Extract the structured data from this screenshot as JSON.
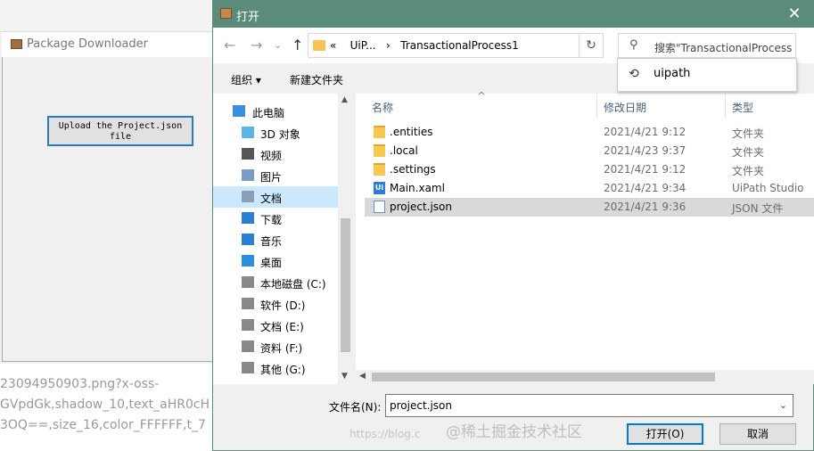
{
  "background_app": {
    "title": "Package Downloader",
    "upload_button": "Upload the Project.json file",
    "url_lines": [
      "23094950903.png?x-oss-",
      "GVpdGk,shadow_10,text_aHR0cH",
      "3OQ==,size_16,color_FFFFFF,t_7"
    ]
  },
  "dialog": {
    "title": "打开",
    "address": {
      "prefix": "«",
      "crumbs": [
        "UiP...",
        "TransactionalProcess1"
      ]
    },
    "search_placeholder": "搜索\"TransactionalProcess",
    "suggestion": "uipath",
    "toolbar": {
      "organize": "组织 ▾",
      "new_folder": "新建文件夹"
    },
    "tree": [
      {
        "label": "此电脑",
        "icon": "computer-icon",
        "selected": false
      },
      {
        "label": "3D 对象",
        "icon": "cube-icon",
        "selected": false
      },
      {
        "label": "视频",
        "icon": "video-icon",
        "selected": false
      },
      {
        "label": "图片",
        "icon": "picture-icon",
        "selected": false
      },
      {
        "label": "文档",
        "icon": "document-icon",
        "selected": true
      },
      {
        "label": "下载",
        "icon": "download-icon",
        "selected": false
      },
      {
        "label": "音乐",
        "icon": "music-icon",
        "selected": false
      },
      {
        "label": "桌面",
        "icon": "desktop-icon",
        "selected": false
      },
      {
        "label": "本地磁盘 (C:)",
        "icon": "drive-icon",
        "selected": false
      },
      {
        "label": "软件 (D:)",
        "icon": "drive-icon",
        "selected": false
      },
      {
        "label": "文档 (E:)",
        "icon": "drive-icon",
        "selected": false
      },
      {
        "label": "资料 (F:)",
        "icon": "drive-icon",
        "selected": false
      },
      {
        "label": "其他 (G:)",
        "icon": "drive-icon",
        "selected": false
      }
    ],
    "columns": {
      "name": "名称",
      "date": "修改日期",
      "type": "类型"
    },
    "files": [
      {
        "name": ".entities",
        "date": "2021/4/21 9:12",
        "type": "文件夹",
        "kind": "folder"
      },
      {
        "name": ".local",
        "date": "2021/4/23 9:37",
        "type": "文件夹",
        "kind": "folder"
      },
      {
        "name": ".settings",
        "date": "2021/4/21 9:12",
        "type": "文件夹",
        "kind": "folder"
      },
      {
        "name": "Main.xaml",
        "date": "2021/4/21 9:34",
        "type": "UiPath Studio",
        "kind": "uipath"
      },
      {
        "name": "project.json",
        "date": "2021/4/21 9:36",
        "type": "JSON 文件",
        "kind": "file",
        "selected": true
      }
    ],
    "filename_label": "文件名(N):",
    "filename_value": "project.json",
    "open_button": "打开(O)",
    "cancel_button": "取消"
  },
  "watermark": {
    "main": "@稀土掘金技术社区",
    "url": "https://blog.c"
  }
}
